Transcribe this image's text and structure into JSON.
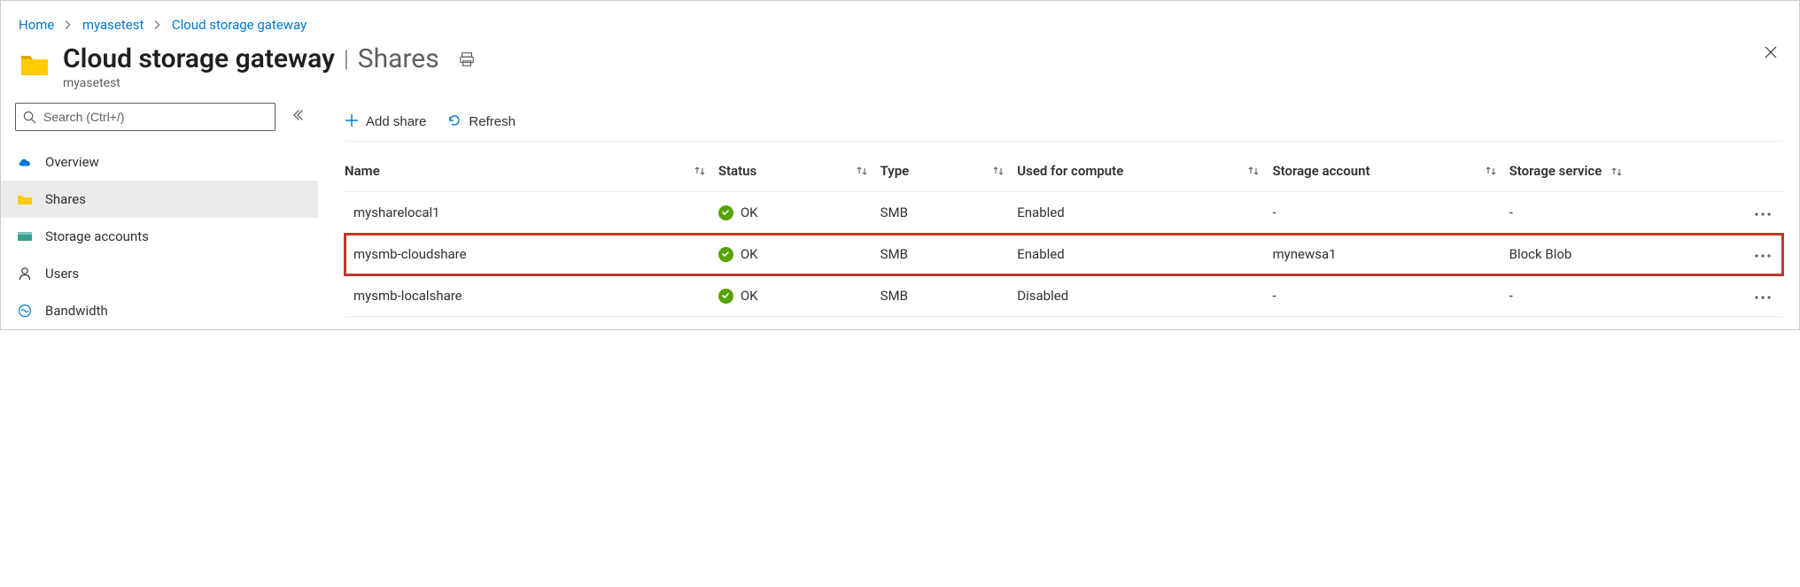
{
  "breadcrumb": [
    {
      "label": "Home"
    },
    {
      "label": "myasetest"
    },
    {
      "label": "Cloud storage gateway"
    }
  ],
  "header": {
    "title": "Cloud storage gateway",
    "section": "Shares",
    "subtitle": "myasetest"
  },
  "sidebar": {
    "search_placeholder": "Search (Ctrl+/)",
    "items": [
      {
        "label": "Overview",
        "icon": "overview"
      },
      {
        "label": "Shares",
        "icon": "shares",
        "active": true
      },
      {
        "label": "Storage accounts",
        "icon": "storage"
      },
      {
        "label": "Users",
        "icon": "users"
      },
      {
        "label": "Bandwidth",
        "icon": "bandwidth"
      }
    ]
  },
  "toolbar": {
    "add_share": "Add share",
    "refresh": "Refresh"
  },
  "table": {
    "columns": {
      "name": "Name",
      "status": "Status",
      "type": "Type",
      "compute": "Used for compute",
      "account": "Storage account",
      "service": "Storage service"
    },
    "rows": [
      {
        "name": "mysharelocal1",
        "status": "OK",
        "type": "SMB",
        "compute": "Enabled",
        "account": "-",
        "service": "-",
        "highlighted": false
      },
      {
        "name": "mysmb-cloudshare",
        "status": "OK",
        "type": "SMB",
        "compute": "Enabled",
        "account": "mynewsa1",
        "service": "Block Blob",
        "highlighted": true
      },
      {
        "name": "mysmb-localshare",
        "status": "OK",
        "type": "SMB",
        "compute": "Disabled",
        "account": "-",
        "service": "-",
        "highlighted": false
      }
    ]
  }
}
